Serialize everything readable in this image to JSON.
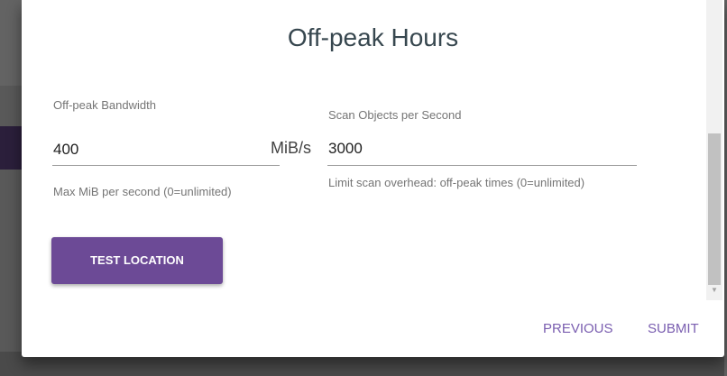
{
  "dialog": {
    "title": "Off-peak Hours"
  },
  "bandwidth": {
    "label": "Off-peak Bandwidth",
    "value": "400",
    "unit": "MiB/s",
    "helper": "Max MiB per second (0=unlimited)"
  },
  "scan": {
    "label": "Scan Objects per Second",
    "value": "3000",
    "helper": "Limit scan overhead: off-peak times (0=unlimited)"
  },
  "buttons": {
    "test_location": "TEST LOCATION",
    "previous": "PREVIOUS",
    "submit": "SUBMIT"
  },
  "icons": {
    "scroll_down": "caret-down-icon"
  },
  "colors": {
    "primary": "#6c4a96",
    "accent_text": "#7a5eb0"
  }
}
